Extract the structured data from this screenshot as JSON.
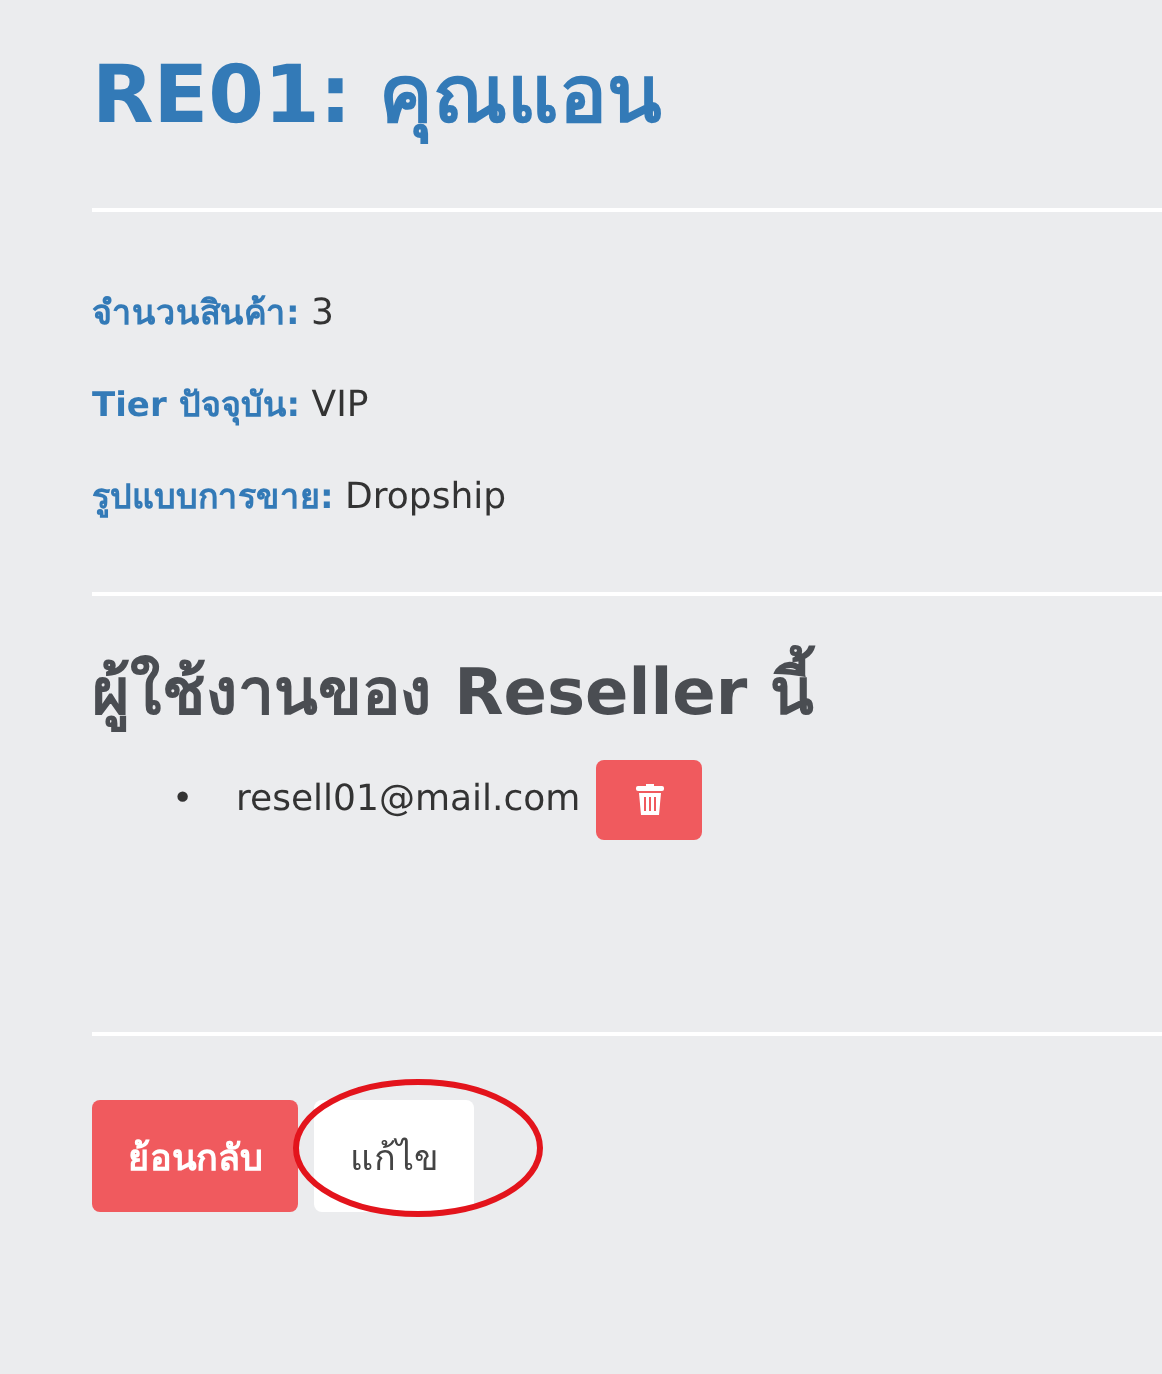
{
  "title": "RE01: คุณแอน",
  "details": [
    {
      "label": "จำนวนสินค้า:",
      "value": "3"
    },
    {
      "label": "Tier ปัจจุบัน:",
      "value": "VIP"
    },
    {
      "label": "รูปแบบการขาย:",
      "value": "Dropship"
    }
  ],
  "users_heading": "ผู้ใช้งานของ Reseller นี้",
  "users": [
    {
      "bullet": "•",
      "email": "resell01@mail.com"
    }
  ],
  "buttons": [
    {
      "label": "ย้อนกลับ",
      "kind": "danger",
      "highlighted": false
    },
    {
      "label": "แก้ไข",
      "kind": "plain",
      "highlighted": true
    }
  ]
}
